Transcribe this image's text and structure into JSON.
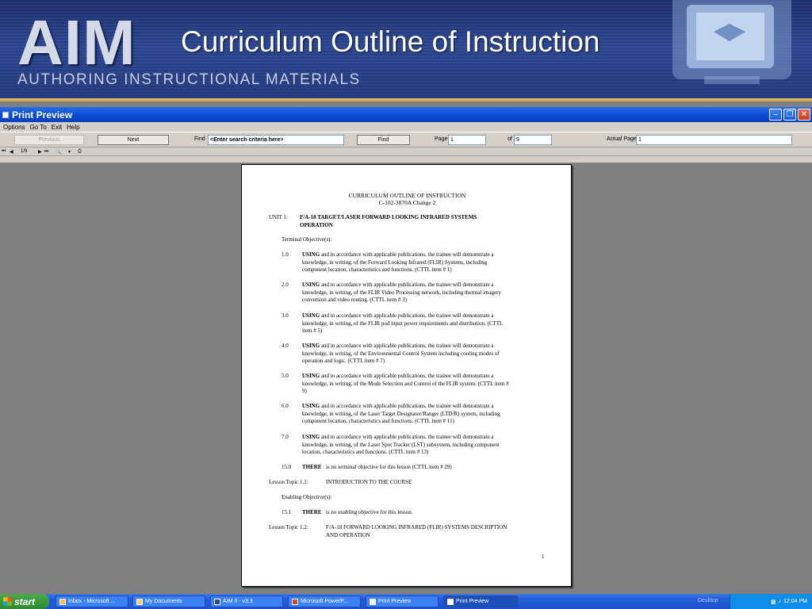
{
  "banner": {
    "logo": "AIM",
    "logo_sub": "AUTHORING INSTRUCTIONAL MATERIALS",
    "title": "Curriculum Outline of Instruction"
  },
  "window": {
    "title": "Print Preview",
    "menu": [
      "Options",
      "Go To",
      "Exit",
      "Help"
    ],
    "toolbar": {
      "previous_label": "Previous",
      "next_label": "Next",
      "find_label": "Find",
      "find_placeholder": "<Enter search criteria here>",
      "find_button": "Find",
      "page_label": "Page",
      "page_value": "1",
      "of_label": "of",
      "of_value": "9",
      "actual_page_label": "Actual Page",
      "actual_page_value": "1"
    },
    "nav": {
      "page_count": "1/9",
      "icons": [
        "first-page-icon",
        "prev-page-icon",
        "next-page-icon",
        "last-page-icon",
        "zoom-icon",
        "print-icon"
      ]
    }
  },
  "document": {
    "header1": "CURRICULUM OUTLINE OF INSTRUCTION",
    "header2": "C-102-3870A Change 2",
    "unit_label": "UNIT 1:",
    "unit_title_1": "F/A-18 TARGET/LASER FORWARD LOOKING INFRARED SYSTEMS",
    "unit_title_2": "OPERATION",
    "terminal_label": "Terminal Objective(s):",
    "objectives": [
      {
        "num": "1.0",
        "bold": "USING",
        "l1": "and in accordance with applicable publications, the trainee will demonstrate a",
        "l2": "knowledge, in writing, of the Forward Looking Infrared (FLIR) Systems, including",
        "l3": "component location, characteristics and functions. (CTTL item # 1)"
      },
      {
        "num": "2.0",
        "bold": "USING",
        "l1": "and in accordance with applicable publications, the trainee will demonstrate a",
        "l2": "knowledge, in writing, of the FLIR Video Processing network, including thermal imagery",
        "l3": "conversion and video routing. (CTTL item # 3)"
      },
      {
        "num": "3.0",
        "bold": "USING",
        "l1": "and in accordance with applicable publications, the trainee will demonstrate a",
        "l2": "knowledge, in writing, of the FLIR pod input power requirements and distribution. (CTTL",
        "l3": "item # 5)"
      },
      {
        "num": "4.0",
        "bold": "USING",
        "l1": "and in accordance with applicable publications, the trainee will demonstrate a",
        "l2": "knowledge, in writing, of the Environmental Control System including cooling modes of",
        "l3": "operation and logic. (CTTL item # 7)"
      },
      {
        "num": "5.0",
        "bold": "USING",
        "l1": "and in accordance with applicable publications, the trainee will demonstrate a",
        "l2": "knowledge, in writing, of the Mode Selection and Control of the FLIR system. (CTTL item #",
        "l3": "9)"
      },
      {
        "num": "6.0",
        "bold": "USING",
        "l1": "and in accordance with applicable publications, the trainee will demonstrate a",
        "l2": "knowledge, in writing, of the Laser Target Designator/Ranger (LTD/R) system, including",
        "l3": "component location, characteristics and functions. (CTTL item # 11)"
      },
      {
        "num": "7.0",
        "bold": "USING",
        "l1": "and in accordance with applicable publications, the trainee will demonstrate a",
        "l2": "knowledge, in writing, of the Laser Spot Tracker (LST) subsystem, including component",
        "l3": "location, characteristics and functions. (CTTL item # 13)"
      }
    ],
    "obj15_num": "15.0",
    "obj15_bold": "THERE",
    "obj15_text": "is no terminal objective for this lesson (CTTL item # 29)",
    "lt11_label": "Lesson Topic 1.1:",
    "lt11_title": "INTRODUCTION TO THE COURSE",
    "enabling_label": "Enabling Objective(s):",
    "eo151_num": "15.1",
    "eo151_bold": "THERE",
    "eo151_text": "is no enabling objective for this lesson.",
    "lt12_label": "Lesson Topic 1.2:",
    "lt12_title_1": "F/A-18 FORWARD LOOKING INFRARED (FLIR) SYSTEMS DESCRIPTION",
    "lt12_title_2": "AND OPERATION",
    "page_number": "1"
  },
  "taskbar": {
    "start": "start",
    "items": [
      "Inbox - Microsoft ...",
      "My Documents",
      "AIM II - v3.3",
      "Microsoft PowerP...",
      "Print Preview",
      "Print Preview"
    ],
    "desktop": "Desktop",
    "clock": "12:04 PM"
  }
}
